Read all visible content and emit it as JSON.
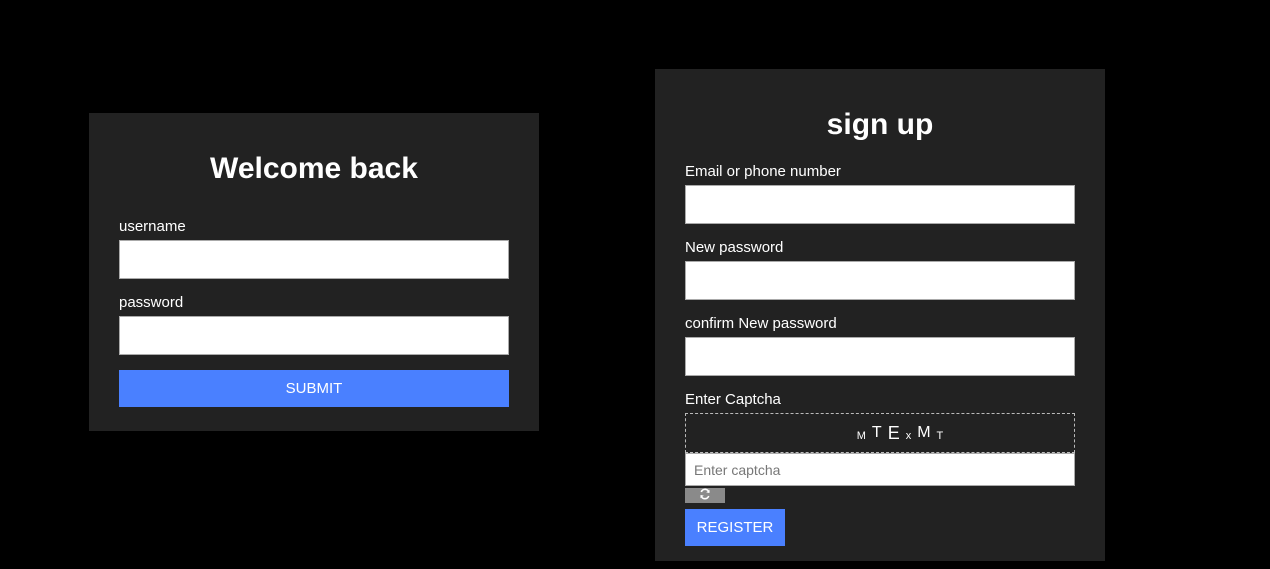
{
  "login": {
    "title": "Welcome back",
    "username_label": "username",
    "username_value": "",
    "password_label": "password",
    "password_value": "",
    "submit_label": "SUBMIT"
  },
  "signup": {
    "title": "sign up",
    "email_label": "Email or phone number",
    "email_value": "",
    "new_password_label": "New password",
    "new_password_value": "",
    "confirm_password_label": "confirm New password",
    "confirm_password_value": "",
    "captcha_label": "Enter Captcha",
    "captcha_chars": [
      "M",
      "T",
      "E",
      "x",
      "M",
      "T"
    ],
    "captcha_placeholder": "Enter captcha",
    "captcha_value": "",
    "refresh_icon": "refresh-icon",
    "register_label": "REGISTER"
  },
  "colors": {
    "page_background": "#000000",
    "panel_background": "#222222",
    "accent": "#4a80ff",
    "refresh_button": "#8a8a8a"
  }
}
